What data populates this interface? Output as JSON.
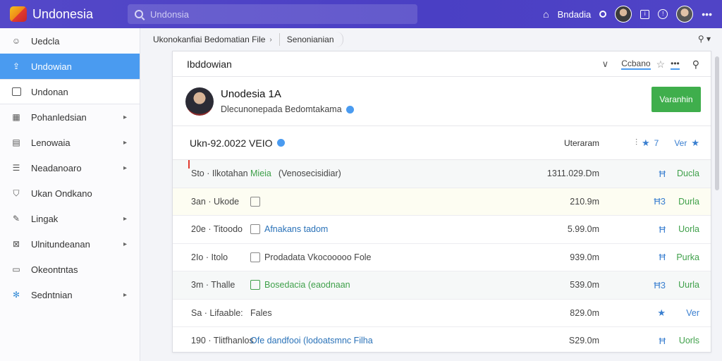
{
  "topbar": {
    "app_name": "Undonesia",
    "search_placeholder": "Undonsia",
    "user_name": "Bndadia"
  },
  "sidebar": {
    "items": [
      {
        "label": "Uedcla",
        "icon": "smile-icon"
      },
      {
        "label": "Undowian",
        "icon": "upload-icon"
      },
      {
        "label": "Undonan",
        "icon": "chart-icon"
      },
      {
        "label": "Pohanledsian",
        "icon": "grid-icon"
      },
      {
        "label": "Lenowaia",
        "icon": "document-icon"
      },
      {
        "label": "Neadanoaro",
        "icon": "list-icon"
      },
      {
        "label": "Ukan Ondkano",
        "icon": "shield-icon"
      },
      {
        "label": "Lingak",
        "icon": "pencil-icon"
      },
      {
        "label": "Ulnitundeanan",
        "icon": "close-box-icon"
      },
      {
        "label": "Okeontntas",
        "icon": "clipboard-icon"
      },
      {
        "label": "Sedntnian",
        "icon": "settings-icon"
      }
    ]
  },
  "breadcrumb": {
    "main": "Ukonokanfiai Bedomatian File",
    "tab": "Senonianian"
  },
  "panel": {
    "title": "Ibddowian",
    "tool_label": "Ccbano",
    "profile": {
      "name": "Unodesia 1A",
      "subtitle": "Dlecunonepada Bedomtakama",
      "button": "Varanhin"
    },
    "section": {
      "title": "Ukn-92.0022 VEIO",
      "column_label": "Uteraram",
      "right_label": "Ver"
    },
    "rows": [
      {
        "c1": "Sto · Ilkotahan",
        "c2a": "Mieia",
        "c2b": "(Venosecisidiar)",
        "c3": "1311.029.Dm",
        "c4": "Ħ",
        "c5": "Ducla"
      },
      {
        "c1": "3an · Ukode",
        "c2b": "",
        "c3": "210.9m",
        "c4": "Ħ3",
        "c5": "Durla"
      },
      {
        "c1": "20e · Titoodo",
        "c2b": "Afnakans tadom",
        "c3": "5.99.0m",
        "c4": "Ħ",
        "c5": "Uorla"
      },
      {
        "c1": "2Io · Itolo",
        "c2b": "Prodadata Vkocooooo Fole",
        "c3": "939.0m",
        "c4": "Ħ",
        "c5": "Purka"
      },
      {
        "c1": "3m · Thalle",
        "c2b": "Bosedacia (eaodnaan",
        "c3": "539.0m",
        "c4": "Ħ3",
        "c5": "Uurla"
      },
      {
        "c1": "Sa · Lifaable:",
        "c2b": "Fales",
        "c3": "829.0m",
        "c4": "★",
        "c5": "Ver"
      },
      {
        "c1": "190 · Tlitfhanlos",
        "c2b": "Ofe dandfooi (lodoatsmnc Filha",
        "c3": "S29.0m",
        "c4": "Ħ",
        "c5": "Uorls"
      }
    ]
  }
}
